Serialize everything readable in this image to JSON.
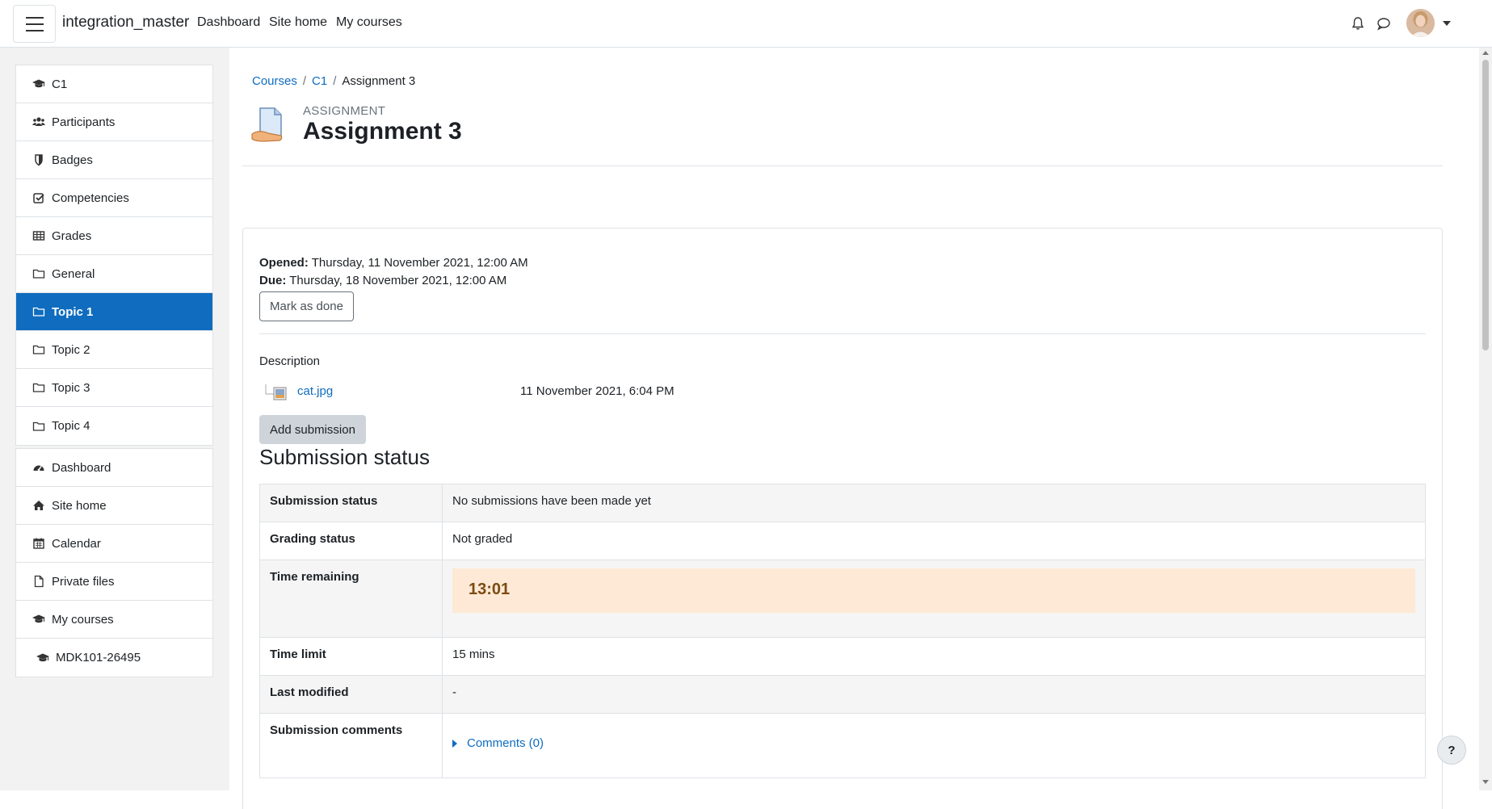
{
  "navbar": {
    "site_name": "integration_master",
    "links": [
      "Dashboard",
      "Site home",
      "My courses"
    ]
  },
  "drawer": {
    "course_items": [
      {
        "label": "C1",
        "icon": "graduation-cap-icon"
      },
      {
        "label": "Participants",
        "icon": "users-icon"
      },
      {
        "label": "Badges",
        "icon": "shield-icon"
      },
      {
        "label": "Competencies",
        "icon": "checkbox-icon"
      },
      {
        "label": "Grades",
        "icon": "table-icon"
      },
      {
        "label": "General",
        "icon": "folder-icon"
      },
      {
        "label": "Topic 1",
        "icon": "folder-icon",
        "active": true
      },
      {
        "label": "Topic 2",
        "icon": "folder-icon"
      },
      {
        "label": "Topic 3",
        "icon": "folder-icon"
      },
      {
        "label": "Topic 4",
        "icon": "folder-icon"
      }
    ],
    "site_items": [
      {
        "label": "Dashboard",
        "icon": "tachometer-icon"
      },
      {
        "label": "Site home",
        "icon": "home-icon"
      },
      {
        "label": "Calendar",
        "icon": "calendar-icon"
      },
      {
        "label": "Private files",
        "icon": "file-icon"
      },
      {
        "label": "My courses",
        "icon": "graduation-cap-icon"
      },
      {
        "label": "MDK101-26495",
        "icon": "graduation-cap-icon"
      }
    ]
  },
  "breadcrumb": {
    "items": [
      "Courses",
      "C1",
      "Assignment 3"
    ],
    "separator": "/"
  },
  "header": {
    "modtype": "ASSIGNMENT",
    "title": "Assignment 3"
  },
  "dates": {
    "opened_label": "Opened:",
    "opened_value": "Thursday, 11 November 2021, 12:00 AM",
    "due_label": "Due:",
    "due_value": "Thursday, 18 November 2021, 12:00 AM"
  },
  "buttons": {
    "mark_done": "Mark as done",
    "add_submission": "Add submission",
    "help": "?"
  },
  "description": {
    "label": "Description",
    "file_name": "cat.jpg",
    "file_date": "11 November 2021, 6:04 PM"
  },
  "submission": {
    "heading": "Submission status",
    "rows": {
      "submission_status": {
        "label": "Submission status",
        "value": "No submissions have been made yet"
      },
      "grading_status": {
        "label": "Grading status",
        "value": "Not graded"
      },
      "time_remaining": {
        "label": "Time remaining",
        "value": "13:01"
      },
      "time_limit": {
        "label": "Time limit",
        "value": "15 mins"
      },
      "last_modified": {
        "label": "Last modified",
        "value": "-"
      },
      "submission_comments": {
        "label": "Submission comments",
        "value": "Comments (0)"
      }
    }
  },
  "colors": {
    "primary": "#0f6cbf",
    "drawer_bg": "#f2f2f2",
    "time_remaining_bg": "#fde9d6"
  }
}
